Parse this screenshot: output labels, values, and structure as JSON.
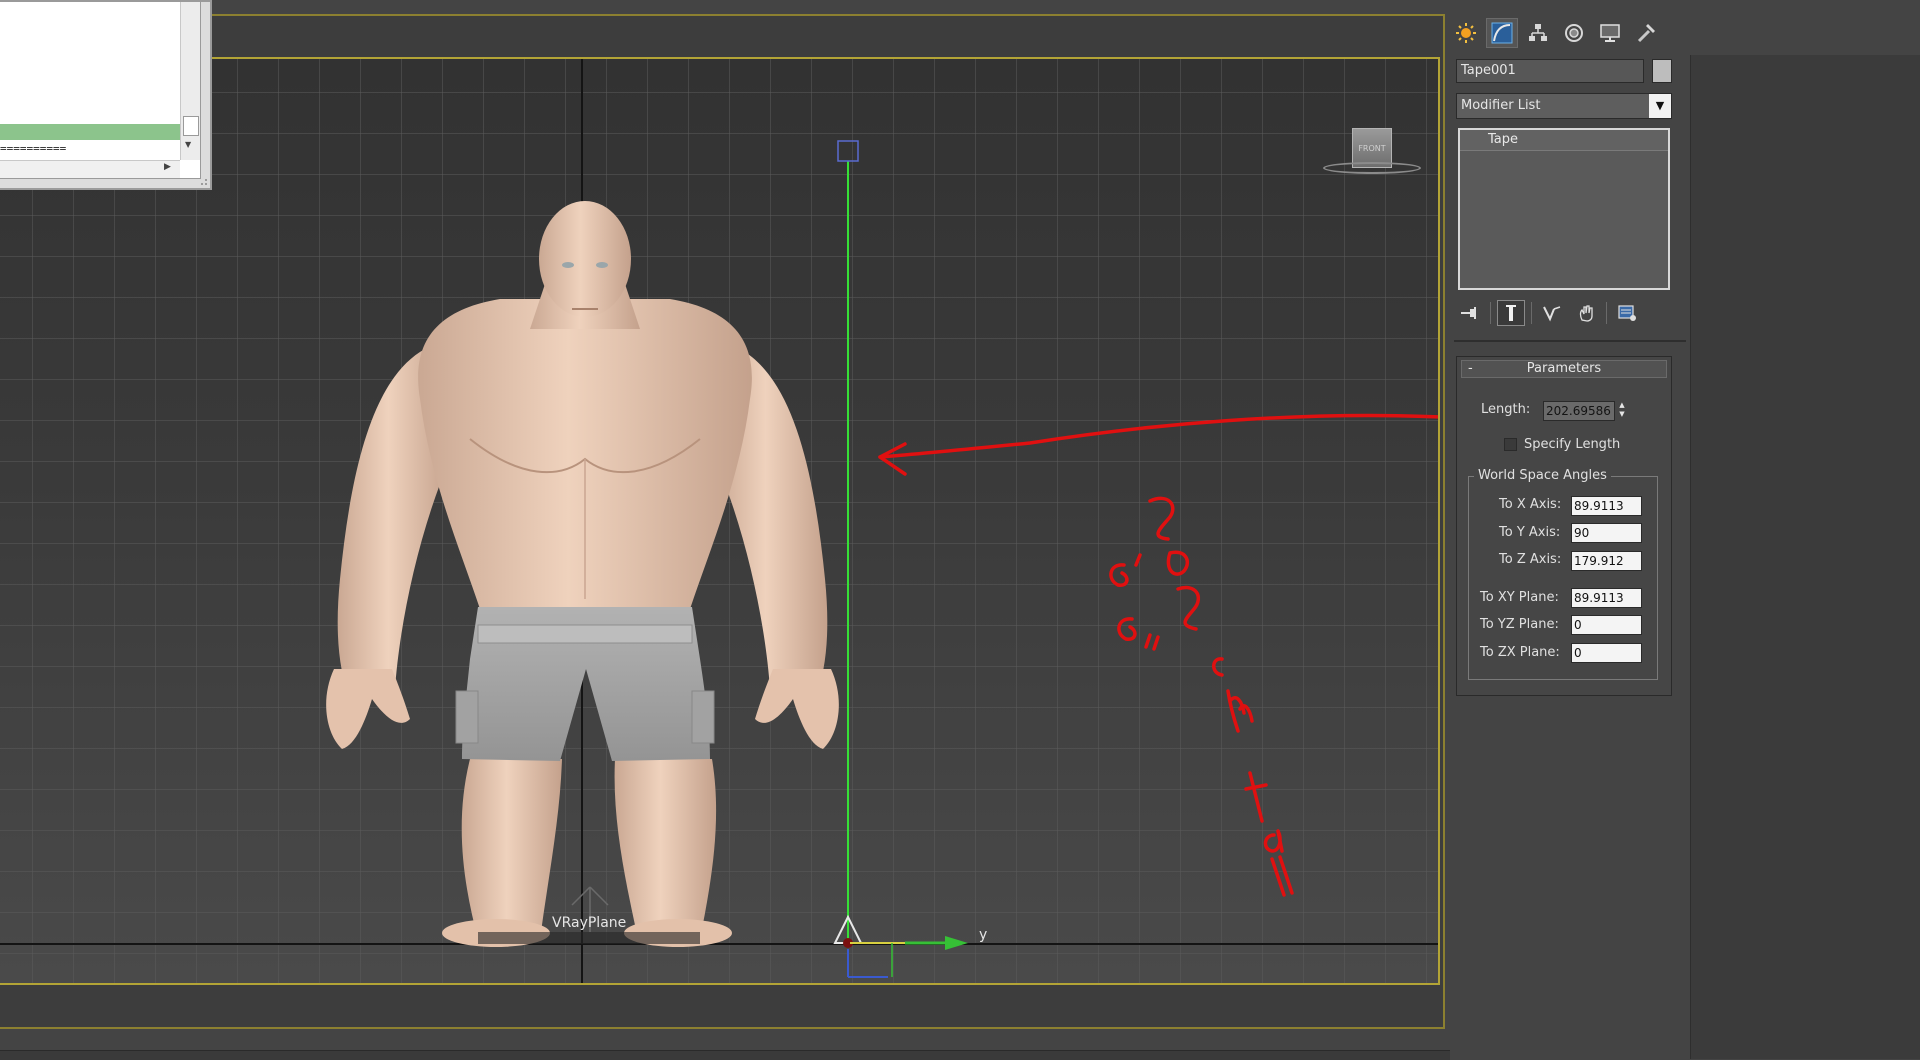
{
  "viewport": {
    "object_label": "VRayPlane",
    "axis_y_label": "y",
    "viewcube_label": "FRONT",
    "annotation_note": "202 cm tall 6'6\""
  },
  "dialog": {
    "separator_text": "=========="
  },
  "command_panel": {
    "tabs": [
      {
        "name": "create",
        "icon": "sun-icon"
      },
      {
        "name": "modify",
        "icon": "curve-icon"
      },
      {
        "name": "hierarchy",
        "icon": "hierarchy-icon"
      },
      {
        "name": "motion",
        "icon": "motion-icon"
      },
      {
        "name": "display",
        "icon": "display-icon"
      },
      {
        "name": "utilities",
        "icon": "hammer-icon"
      }
    ],
    "object_name": "Tape001",
    "modifier_list": "Modifier List",
    "stack_items": [
      "Tape"
    ],
    "parameters": {
      "rollout_title": "Parameters",
      "collapse_symbol": "-",
      "length_label": "Length:",
      "length_value": "202.69586",
      "specify_length_label": "Specify Length",
      "world_space_angles_title": "World Space Angles",
      "to_x_axis_label": "To X Axis:",
      "to_x_axis_value": "89.9113",
      "to_y_axis_label": "To Y Axis:",
      "to_y_axis_value": "90",
      "to_z_axis_label": "To Z Axis:",
      "to_z_axis_value": "179.912",
      "to_xy_plane_label": "To XY Plane:",
      "to_xy_plane_value": "89.9113",
      "to_yz_plane_label": "To YZ Plane:",
      "to_yz_plane_value": "0",
      "to_zx_plane_label": "To ZX Plane:",
      "to_zx_plane_value": "0"
    }
  },
  "colors": {
    "viewport_border": "#b3a436",
    "annotation": "#e01010",
    "tape_line": "#36e036",
    "skin": "#e8c7b0",
    "shorts": "#a8a8a8"
  }
}
